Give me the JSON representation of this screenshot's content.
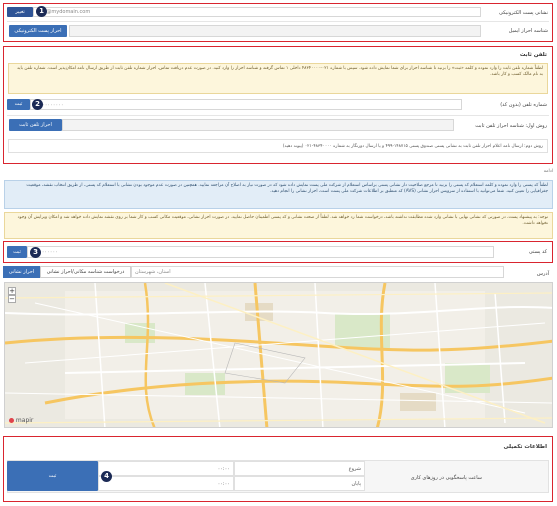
{
  "email_section": {
    "email_label": "نشانی پست الکترونیکی",
    "email_value": "info@mydomain.com",
    "change_button": "تغییر",
    "confirm_email_label": "شناسه احراز ایمیل",
    "verify_email_button": "احراز پست الکترونیکی",
    "badge": "1"
  },
  "phone_section": {
    "title": "تلفن ثابت",
    "alert_text": "لطفاً شماره تلفن ثابت را وارد نموده و کلمه «ثبت» را بزنید تا شناسه احراز برای شما نمایش داده شود. سپس با شماره ۰۲۱-۴۸۳۴۰۰۰۰ داخلی ۱ تماس گرفته و شناسه احراز را وارد کنید. در صورت عدم دریافت تماس، احراز شماره تلفن ثابت از طریق ارسال نامه امکان‌پذیر است. شماره تلفن باید به نام مالک کسب و کار باشد.",
    "phone_label": "شماره تلفن (بدون کد)",
    "phone_placeholder": "۰۲۱۰۰۰۰۰۰۰۰",
    "submit_button": "ثبت",
    "badge": "2",
    "method_label": "روش اول: شناسه احراز تلفن ثابت",
    "verify_phone_button": "احراز تلفن ثابت",
    "note_text": "روش دوم: ارسال نامه اعلام احراز تلفن ثابت به نشانی پستی صندوق پستی ۱۴۸۷۱۵-۴۹۹ و یا ارسال دورنگار به شماره ۴۸۳۴۰۰۰۰-۰۲۱ (پیوند دهید)",
    "footnote": "ادامه"
  },
  "address_section": {
    "alert_blue_text": "لطفاً کد پستی را وارد نموده و کلمه استعلام کد پستی را بزنید تا مرجع صلاحیت دار نشانی پستی براساس استعلام از شرکت ملی پست نمایش داده شود که در صورت نیاز به اصلاح آن مراجعه نمایید. همچنین در صورت عدم موجود بودن نشانی با استعلام کد پستی، از طریق انتخاب نقشه، موقعیت جغرافیایی را تعیین کنید. شما می‌توانید با استفاده از سرویس احراز نشانی (AVS) که منطبق بر اطلاعات شرکت ملی پست است، احراز نشانی را انجام دهید.",
    "alert_yellow_text": "توجه: به پیشنهاد پست، در صورتی که نشانی نهایی با نشانی وارد شده مطابقت نداشته باشد، درخواست شما رد خواهد شد. لطفاً از صحت نشانی و کد پستی اطمینان حاصل نمایید. در صورت احراز نشانی، موقعیت مکانی کسب و کار شما بر روی نقشه نمایش داده خواهد شد و امکان ویرایش آن وجود نخواهد داشت.",
    "postcode_label": "کد پستی",
    "postcode_placeholder": "۰۰۰۰۰۰۰۰۰۰",
    "submit_button": "ثبت",
    "badge": "3",
    "address_label": "آدرس",
    "address_placeholder": "استان، شهرستان",
    "tab_verify": "احراز نشانی",
    "tab_request": "درخواست شناسه مکانی/احراز نشانی",
    "map_brand": "mapir",
    "zoom_in": "+",
    "zoom_out": "−"
  },
  "hours_section": {
    "title": "اطلاعات تکمیلی",
    "hours_label": "ساعت پاسخگویی در روزهای کاری",
    "start_label": "شروع",
    "end_label": "پایان",
    "start_value": "۰۰:۰۰",
    "end_value": "۰۰:۰۰",
    "submit_button": "ثبت",
    "badge": "4"
  },
  "colors": {
    "accent": "#3b6fb6",
    "annotation_border": "#d9252f",
    "badge": "#1b2a55"
  }
}
